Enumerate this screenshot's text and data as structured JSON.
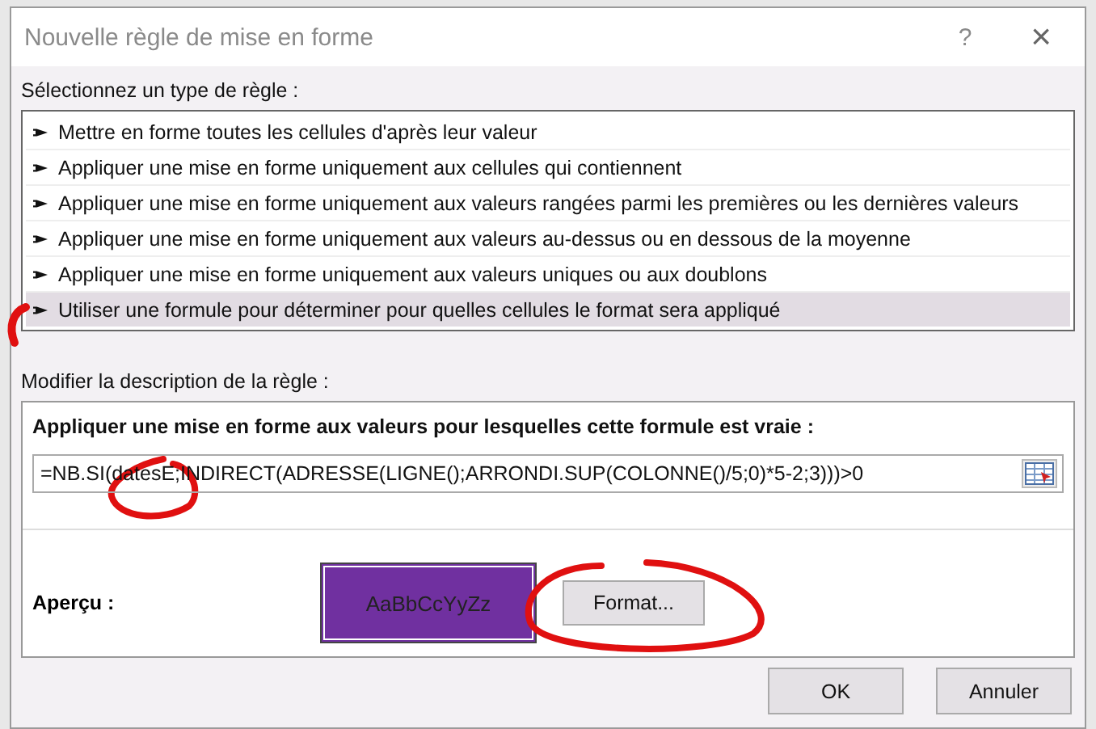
{
  "window": {
    "title": "Nouvelle règle de mise en forme",
    "help": "?",
    "close": "×"
  },
  "rule_types": {
    "label": "Sélectionnez un type de règle :",
    "items": [
      {
        "label": "Mettre en forme toutes les cellules d'après leur valeur",
        "selected": false
      },
      {
        "label": "Appliquer une mise en forme uniquement aux cellules qui contiennent",
        "selected": false
      },
      {
        "label": "Appliquer une mise en forme uniquement aux valeurs rangées parmi les premières ou les dernières valeurs",
        "selected": false
      },
      {
        "label": "Appliquer une mise en forme uniquement aux valeurs au-dessus ou en dessous de la moyenne",
        "selected": false
      },
      {
        "label": "Appliquer une mise en forme uniquement aux valeurs uniques ou aux doublons",
        "selected": false
      },
      {
        "label": "Utiliser une formule pour déterminer pour quelles cellules le format sera appliqué",
        "selected": true
      }
    ]
  },
  "description": {
    "label": "Modifier la description de la règle :",
    "heading": "Appliquer une mise en forme aux valeurs pour lesquelles cette formule est vraie :",
    "formula": "=NB.SI(datesE;INDIRECT(ADRESSE(LIGNE();ARRONDI.SUP(COLONNE()/5;0)*5-2;3)))>0",
    "preview_label": "Aperçu :",
    "preview_text": "AaBbCcYyZz",
    "format_button": "Format..."
  },
  "buttons": [
    "OK",
    "Annuler"
  ]
}
